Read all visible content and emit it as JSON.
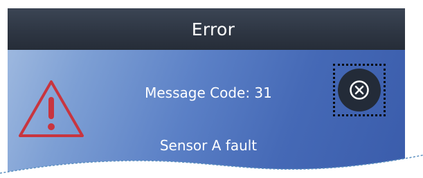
{
  "dialog": {
    "title": "Error",
    "message_code": "Message Code: 31",
    "fault_message": "Sensor A fault"
  },
  "icons": {
    "warning": "warning-triangle-icon",
    "close": "close-circle-x-icon"
  },
  "colors": {
    "title_bar": "#2d3542",
    "panel_light": "#9db8df",
    "panel_dark": "#3a5cab",
    "warning_red": "#c8353f",
    "close_button_bg": "#232b38",
    "text": "#ffffff",
    "torn_edge": "#5a8fc0"
  }
}
